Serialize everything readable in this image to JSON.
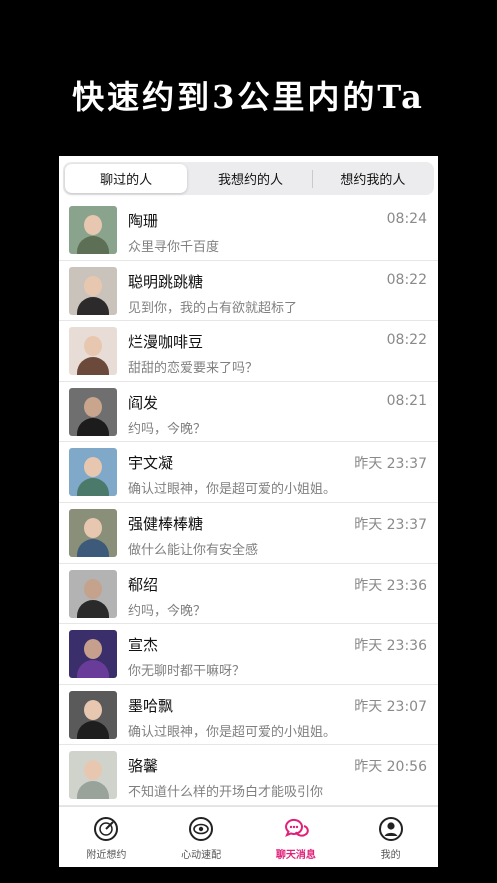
{
  "headline": "快速约到3公里内的Ta",
  "segments": [
    {
      "label": "聊过的人",
      "active": true
    },
    {
      "label": "我想约的人",
      "active": false
    },
    {
      "label": "想约我的人",
      "active": false
    }
  ],
  "chats": [
    {
      "name": "陶珊",
      "message": "众里寻你千百度",
      "time": "08:24"
    },
    {
      "name": "聪明跳跳糖",
      "message": "见到你，我的占有欲就超标了",
      "time": "08:22"
    },
    {
      "name": "烂漫咖啡豆",
      "message": "甜甜的恋爱要来了吗？",
      "time": "08:22"
    },
    {
      "name": "阎发",
      "message": "约吗，今晚？",
      "time": "08:21"
    },
    {
      "name": "宇文凝",
      "message": "确认过眼神，你是超可爱的小姐姐。",
      "time": "昨天 23:37"
    },
    {
      "name": "强健棒棒糖",
      "message": "做什么能让你有安全感",
      "time": "昨天 23:37"
    },
    {
      "name": "郗绍",
      "message": "约吗，今晚？",
      "time": "昨天 23:36"
    },
    {
      "name": "宣杰",
      "message": "你无聊时都干嘛呀？",
      "time": "昨天 23:36"
    },
    {
      "name": "墨哈飘",
      "message": "确认过眼神，你是超可爱的小姐姐。",
      "time": "昨天 23:07"
    },
    {
      "name": "骆馨",
      "message": "不知道什么样的开场白才能吸引你",
      "time": "昨天 20:56"
    }
  ],
  "tabbar": [
    {
      "label": "附近想约",
      "icon": "radar-icon",
      "active": false
    },
    {
      "label": "心动速配",
      "icon": "eye-icon",
      "active": false
    },
    {
      "label": "聊天消息",
      "icon": "chat-bubbles-icon",
      "active": true
    },
    {
      "label": "我的",
      "icon": "profile-icon",
      "active": false
    }
  ],
  "colors": {
    "accent": "#e0217a",
    "background": "#000000"
  }
}
